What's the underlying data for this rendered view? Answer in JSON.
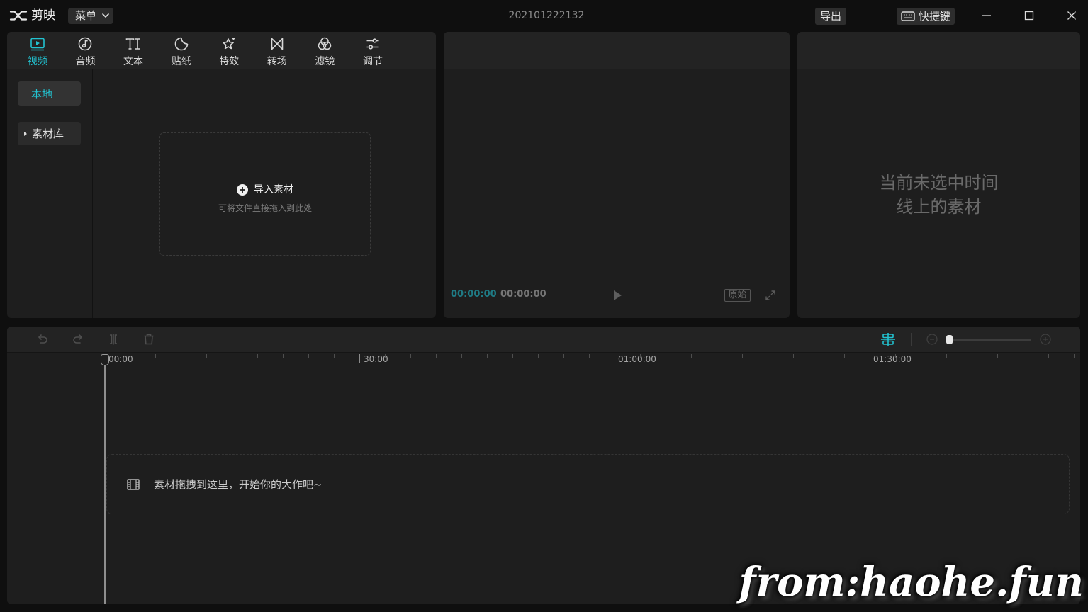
{
  "titlebar": {
    "app_name": "剪映",
    "menu_label": "菜单",
    "project_title": "202101222132",
    "export_label": "导出",
    "shortcuts_label": "快捷键"
  },
  "media_panel": {
    "tabs": [
      {
        "label": "视频",
        "icon": "video-icon",
        "active": true
      },
      {
        "label": "音频",
        "icon": "audio-icon",
        "active": false
      },
      {
        "label": "文本",
        "icon": "text-icon",
        "active": false
      },
      {
        "label": "贴纸",
        "icon": "sticker-icon",
        "active": false
      },
      {
        "label": "特效",
        "icon": "effects-icon",
        "active": false
      },
      {
        "label": "转场",
        "icon": "transition-icon",
        "active": false
      },
      {
        "label": "滤镜",
        "icon": "filter-icon",
        "active": false
      },
      {
        "label": "调节",
        "icon": "adjust-icon",
        "active": false
      }
    ],
    "sidebar": [
      {
        "label": "本地",
        "active": true
      },
      {
        "label": "素材库",
        "active": false,
        "expandable": true
      }
    ],
    "import": {
      "label": "导入素材",
      "hint": "可将文件直接拖入到此处"
    }
  },
  "player": {
    "current_time": "00:00:00",
    "total_time": "00:00:00",
    "ratio_label": "原始"
  },
  "inspector": {
    "empty_message": [
      "当前未选中时间",
      "线上的素材"
    ]
  },
  "timeline": {
    "toolbar_icons": [
      "undo-icon",
      "redo-icon",
      "split-icon",
      "delete-icon",
      "snap-icon",
      "zoom-out-icon",
      "zoom-in-icon"
    ],
    "zoom_level": 0,
    "ruler_labels": [
      "00:00",
      "30:00",
      "01:00:00",
      "01:30:00"
    ],
    "drop_hint": "素材拖拽到这里，开始你的大作吧~"
  },
  "watermark": "from:haohe.fun",
  "colors": {
    "accent": "#22c3d1",
    "bg": "#0f0f0f",
    "panel": "#1e1e1e",
    "panel_header": "#232323",
    "time_current": "#1f7b85"
  }
}
